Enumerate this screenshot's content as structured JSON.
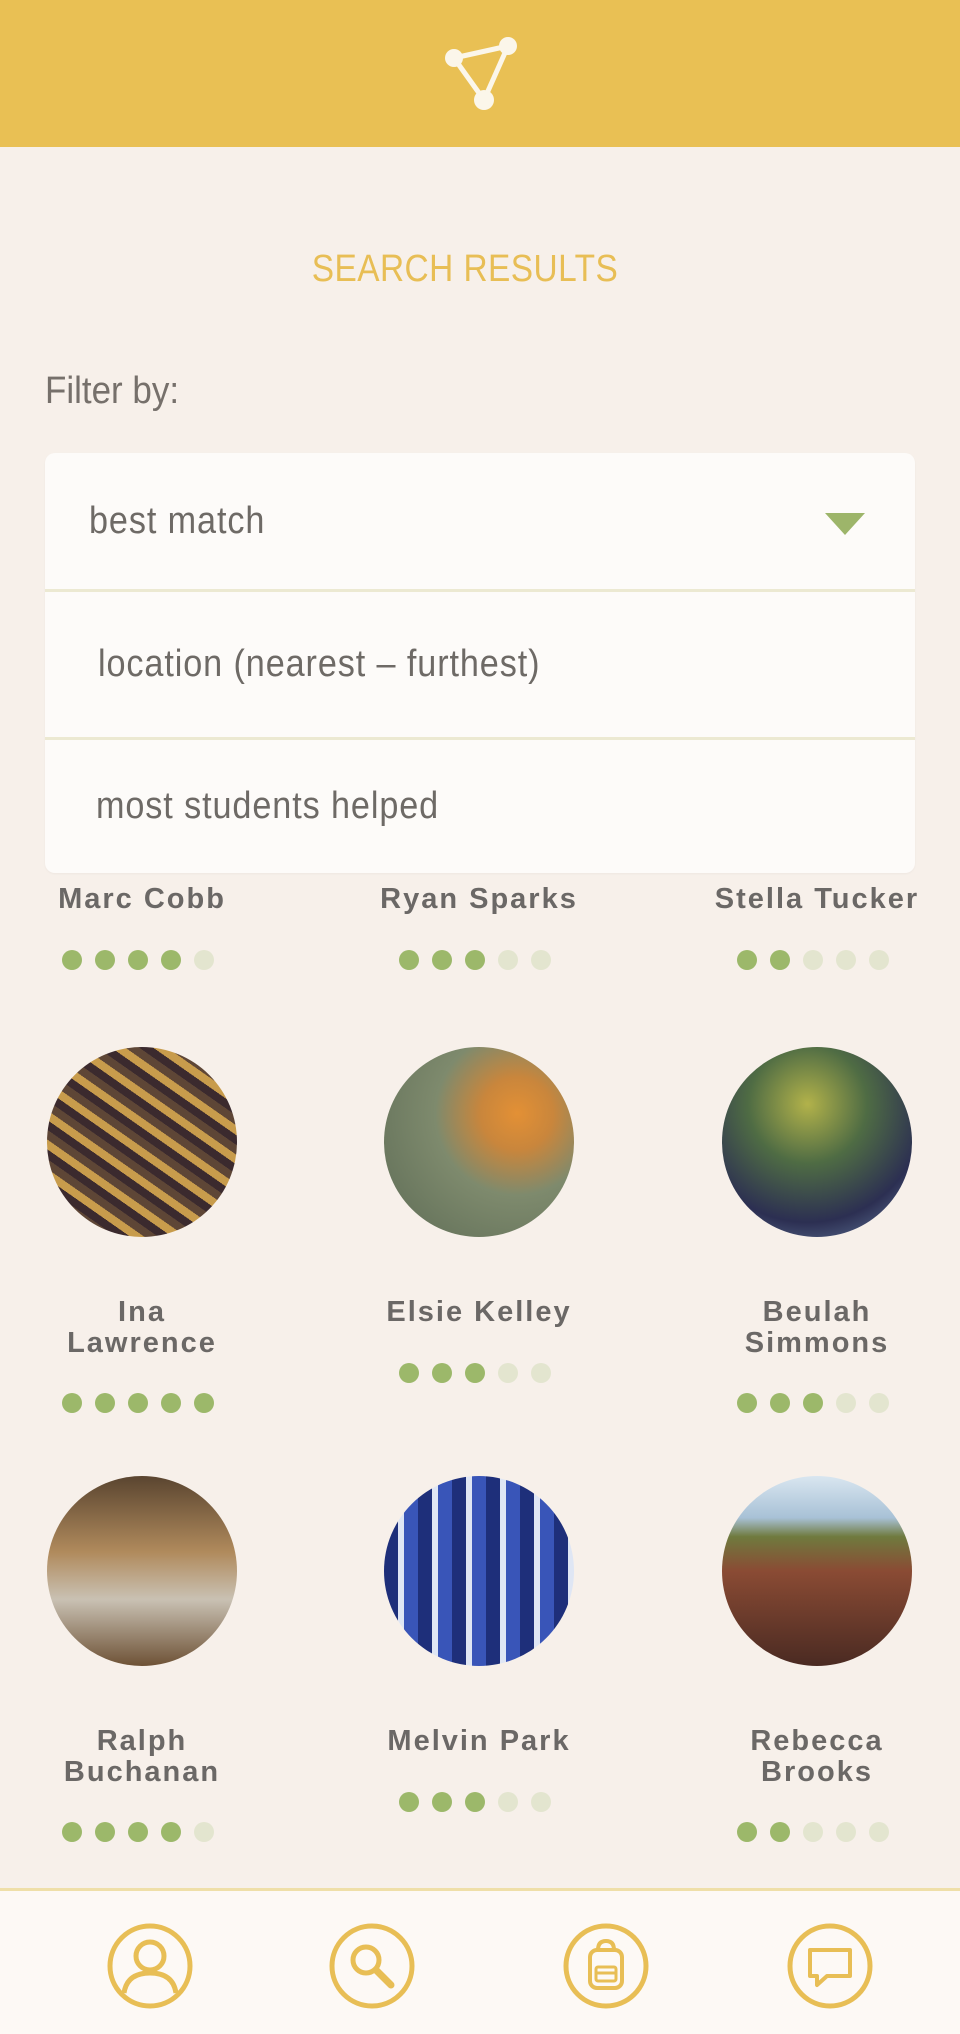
{
  "header": {
    "logo_icon": "share-network-icon",
    "bg_color": "#e9c054"
  },
  "page": {
    "title": "SEARCH RESULTS",
    "filter_label": "Filter by:"
  },
  "filter": {
    "selected": "best match",
    "options": [
      "location (nearest – furthest)",
      "most students helped"
    ],
    "caret_icon": "caret-down-icon"
  },
  "colors": {
    "accent": "#e8be55",
    "rating_on": "#9cb86a",
    "rating_off": "#e3e5cf",
    "background": "#f7f0ea"
  },
  "results": [
    {
      "name": "Marc Cobb",
      "rating": 4
    },
    {
      "name": "Ryan Sparks",
      "rating": 3
    },
    {
      "name": "Stella Tucker",
      "rating": 2
    },
    {
      "name": "Ina Lawrence",
      "rating": 5
    },
    {
      "name": "Elsie Kelley",
      "rating": 3
    },
    {
      "name": "Beulah Simmons",
      "rating": 3
    },
    {
      "name": "Ralph Buchanan",
      "rating": 4
    },
    {
      "name": "Melvin Park",
      "rating": 3
    },
    {
      "name": "Rebecca Brooks",
      "rating": 2
    }
  ],
  "rating_max": 5,
  "nav": [
    {
      "icon": "profile-icon"
    },
    {
      "icon": "search-icon"
    },
    {
      "icon": "backpack-icon"
    },
    {
      "icon": "chat-icon"
    }
  ]
}
